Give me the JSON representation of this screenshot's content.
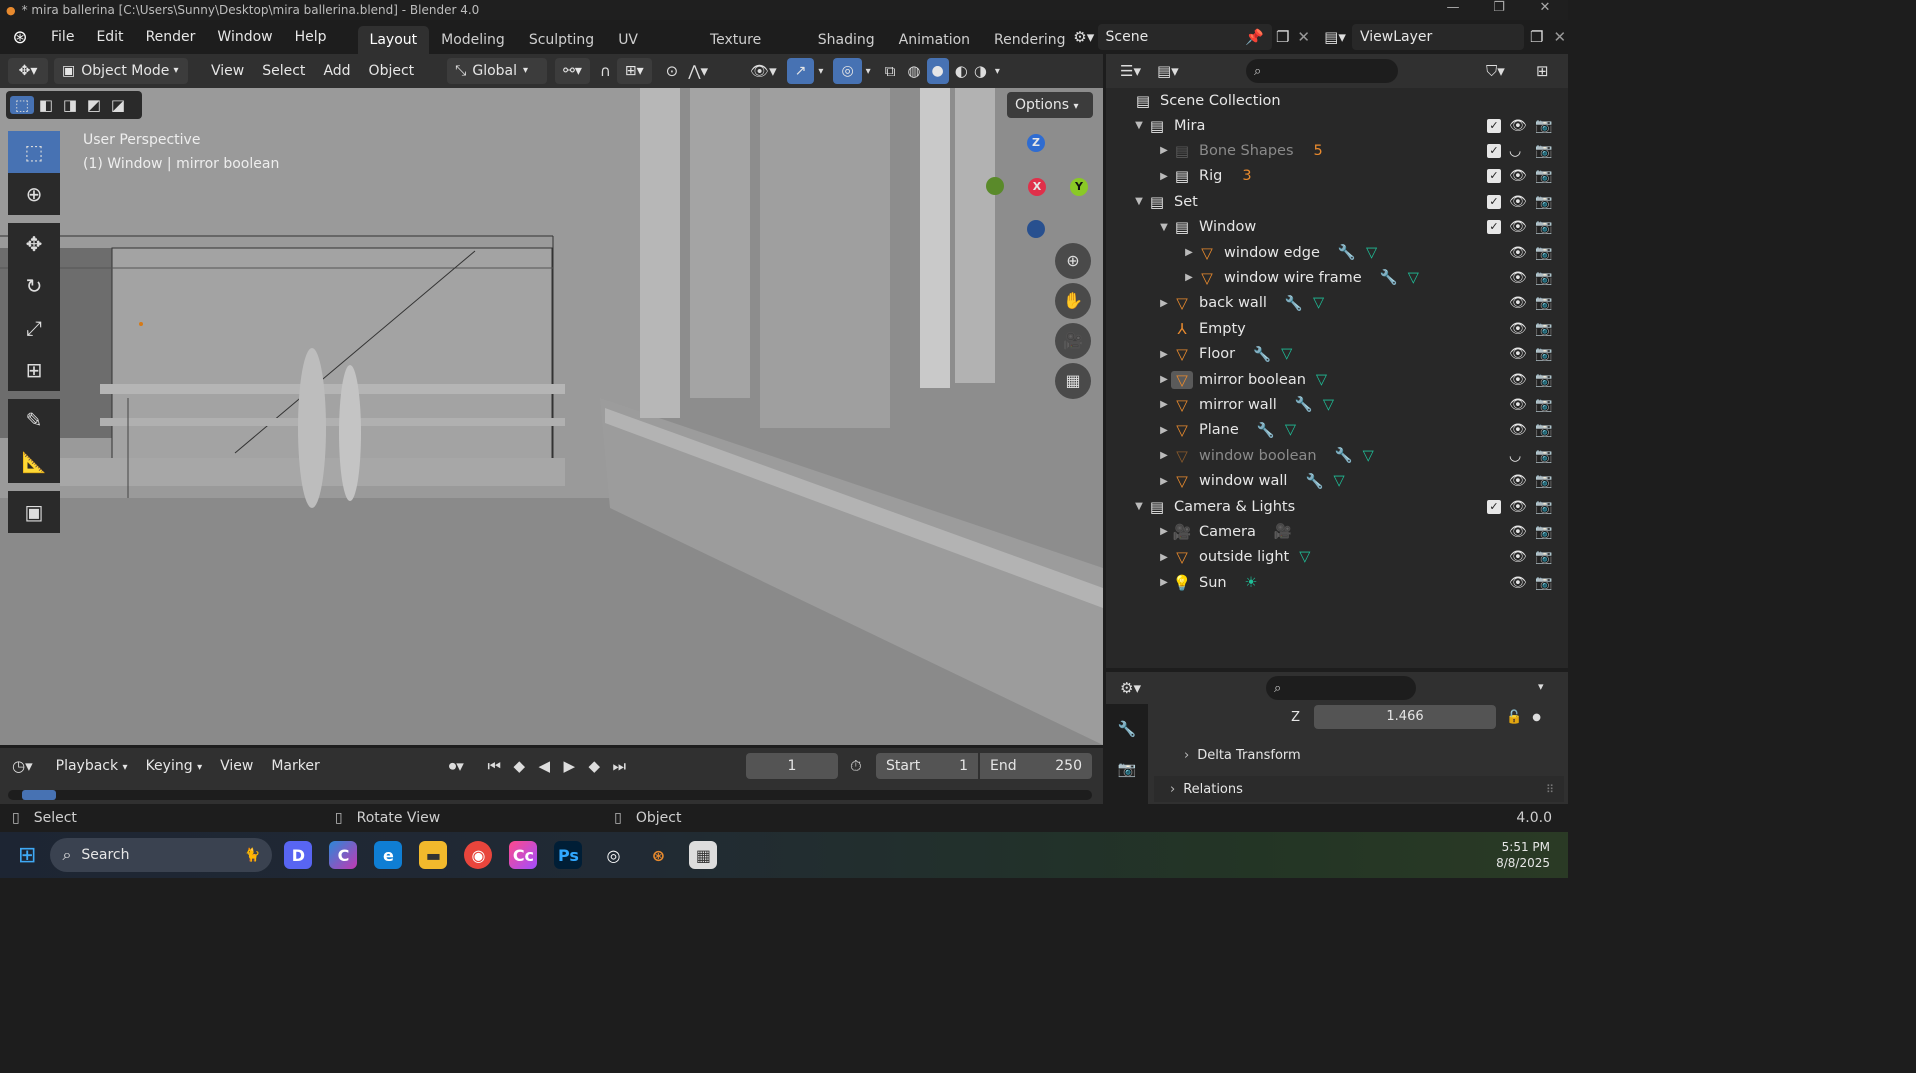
{
  "window": {
    "title": "* mira ballerina [C:\\Users\\Sunny\\Desktop\\mira ballerina.blend] - Blender 4.0",
    "min": "—",
    "max": "❐",
    "close": "✕"
  },
  "menu": [
    "File",
    "Edit",
    "Render",
    "Window",
    "Help"
  ],
  "workspaces": [
    {
      "label": "Layout",
      "active": true
    },
    {
      "label": "Modeling"
    },
    {
      "label": "Sculpting"
    },
    {
      "label": "UV Editing"
    },
    {
      "label": "Texture Paint"
    },
    {
      "label": "Shading"
    },
    {
      "label": "Animation"
    },
    {
      "label": "Rendering"
    }
  ],
  "scene": {
    "name": "Scene",
    "viewlayer": "ViewLayer"
  },
  "viewport_header": {
    "mode": "Object Mode",
    "menus": [
      "View",
      "Select",
      "Add",
      "Object"
    ],
    "orientation": "Global",
    "options": "Options"
  },
  "viewport": {
    "line1": "User Perspective",
    "line2": "(1) Window | mirror boolean"
  },
  "gizmo": {
    "z": "Z",
    "x": "X",
    "y": "Y"
  },
  "outliner": {
    "root": "Scene Collection",
    "rows": [
      {
        "label": "Mira",
        "level": 1,
        "type": "collection",
        "open": true,
        "check": true
      },
      {
        "label": "Bone Shapes",
        "level": 2,
        "type": "collection",
        "dim": true,
        "check": true,
        "badge": "5",
        "hidden": true
      },
      {
        "label": "Rig",
        "level": 2,
        "type": "collection",
        "check": true,
        "badge": "3"
      },
      {
        "label": "Set",
        "level": 1,
        "type": "collection",
        "open": true,
        "check": true
      },
      {
        "label": "Window",
        "level": 2,
        "type": "collection",
        "open": true,
        "check": true
      },
      {
        "label": "window edge",
        "level": 3,
        "type": "mesh",
        "mod": true
      },
      {
        "label": "window wire frame",
        "level": 3,
        "type": "mesh",
        "mod": true
      },
      {
        "label": "back wall",
        "level": 2,
        "type": "mesh",
        "mod": true
      },
      {
        "label": "Empty",
        "level": 2,
        "type": "empty",
        "noarrow": true
      },
      {
        "label": "Floor",
        "level": 2,
        "type": "mesh",
        "mod": true
      },
      {
        "label": "mirror boolean",
        "level": 2,
        "type": "mesh",
        "active": true
      },
      {
        "label": "mirror wall",
        "level": 2,
        "type": "mesh",
        "mod": true
      },
      {
        "label": "Plane",
        "level": 2,
        "type": "mesh",
        "mod": true
      },
      {
        "label": "window boolean",
        "level": 2,
        "type": "mesh",
        "mod": true,
        "dim": true,
        "hidden": true
      },
      {
        "label": "window wall",
        "level": 2,
        "type": "mesh",
        "mod": true
      },
      {
        "label": "Camera & Lights",
        "level": 1,
        "type": "collection",
        "open": true,
        "check": true
      },
      {
        "label": "Camera",
        "level": 2,
        "type": "camera"
      },
      {
        "label": "outside light",
        "level": 2,
        "type": "mesh"
      },
      {
        "label": "Sun",
        "level": 2,
        "type": "light"
      }
    ]
  },
  "properties": {
    "z_label": "Z",
    "z_value": "1.466",
    "delta": "Delta Transform",
    "relations": "Relations"
  },
  "timeline": {
    "playback": "Playback",
    "keying": "Keying",
    "view": "View",
    "marker": "Marker",
    "frame": "1",
    "start_label": "Start",
    "start": "1",
    "end_label": "End",
    "end": "250"
  },
  "status": {
    "select": "Select",
    "rotate": "Rotate View",
    "object": "Object",
    "version": "4.0.0"
  },
  "taskbar": {
    "search": "Search",
    "time": "5:51 PM",
    "date": "8/8/2025"
  }
}
